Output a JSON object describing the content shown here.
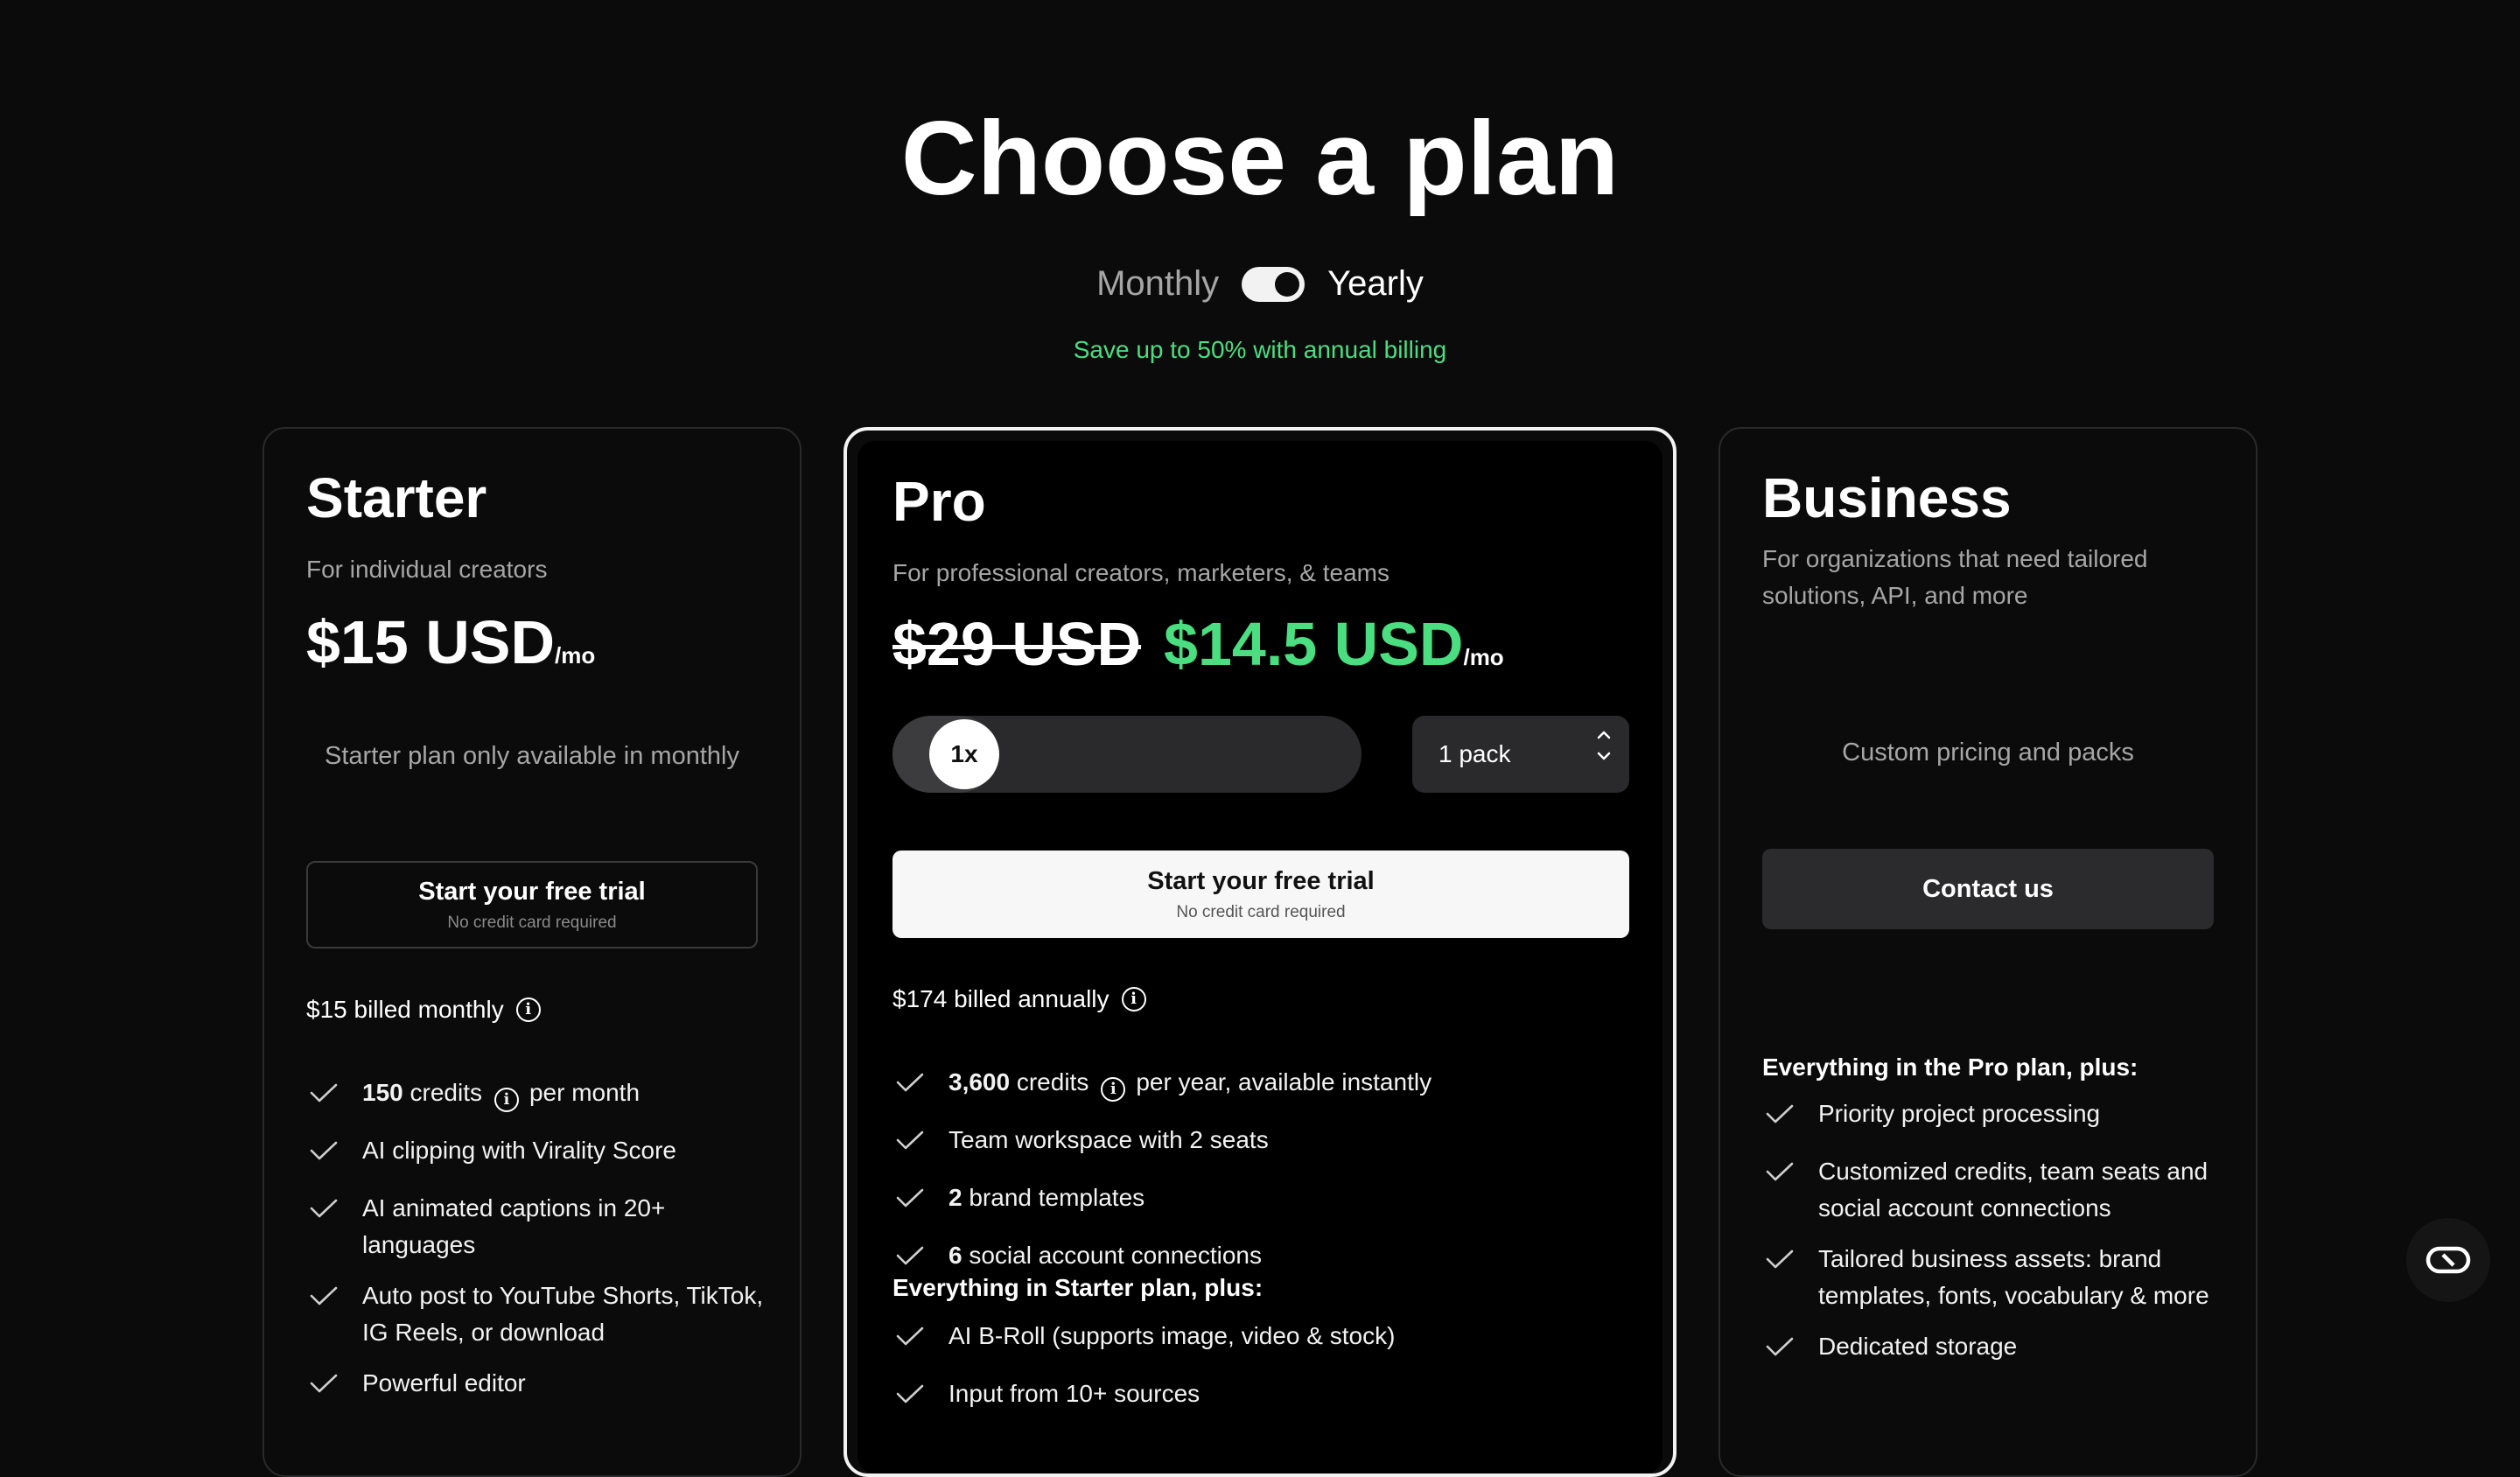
{
  "header": {
    "title": "Choose a plan"
  },
  "billing": {
    "monthly_label": "Monthly",
    "yearly_label": "Yearly",
    "selected": "Yearly",
    "save_note": "Save up to 50% with annual billing"
  },
  "starter": {
    "name": "Starter",
    "subtitle": "For individual creators",
    "price": "$15 USD",
    "per": "/mo",
    "availability_note": "Starter plan only available in monthly",
    "cta": {
      "label": "Start your free trial",
      "sub": "No credit card required"
    },
    "billed": "$15 billed monthly",
    "features": [
      {
        "bold": "150",
        "text": " credits",
        "after": "per month",
        "info": true
      },
      {
        "bold": "",
        "text": "AI clipping with Virality Score"
      },
      {
        "bold": "",
        "text": "AI animated captions in 20+ languages"
      },
      {
        "bold": "",
        "text": "Auto post to YouTube Shorts, TikTok, IG Reels, or download"
      },
      {
        "bold": "",
        "text": "Powerful editor"
      }
    ]
  },
  "pro": {
    "name": "Pro",
    "subtitle": "For professional creators, marketers, & teams",
    "old_price": "$29 USD",
    "price": "$14.5 USD",
    "per": "/mo",
    "multiplier": "1x",
    "pack_value": "1 pack",
    "cta": {
      "label": "Start your free trial",
      "sub": "No credit card required"
    },
    "billed": "$174 billed annually",
    "features": [
      {
        "bold": "3,600",
        "text": " credits",
        "after": "per year, available instantly",
        "info": true
      },
      {
        "bold": "",
        "text": "Team workspace with 2 seats"
      },
      {
        "bold": "2",
        "text": " brand templates"
      },
      {
        "bold": "6",
        "text": " social account connections"
      }
    ],
    "plus_heading": "Everything in Starter plan, plus:",
    "plus_features": [
      {
        "bold": "",
        "text": "AI B-Roll (supports image, video & stock)"
      },
      {
        "bold": "",
        "text": "Input from 10+ sources"
      }
    ]
  },
  "business": {
    "name": "Business",
    "subtitle": "For organizations that need tailored solutions, API, and more",
    "pricing_note": "Custom pricing and packs",
    "cta": {
      "label": "Contact us"
    },
    "plus_heading": "Everything in the Pro plan, plus:",
    "features": [
      {
        "bold": "",
        "text": "Priority project processing"
      },
      {
        "bold": "",
        "text": "Customized credits, team seats and social account connections"
      },
      {
        "bold": "",
        "text": "Tailored business assets: brand templates, fonts, vocabulary & more"
      },
      {
        "bold": "",
        "text": "Dedicated storage"
      }
    ]
  },
  "icons": {
    "check": "check-icon",
    "info": "info-icon",
    "chat": "chat-bubble-icon"
  }
}
